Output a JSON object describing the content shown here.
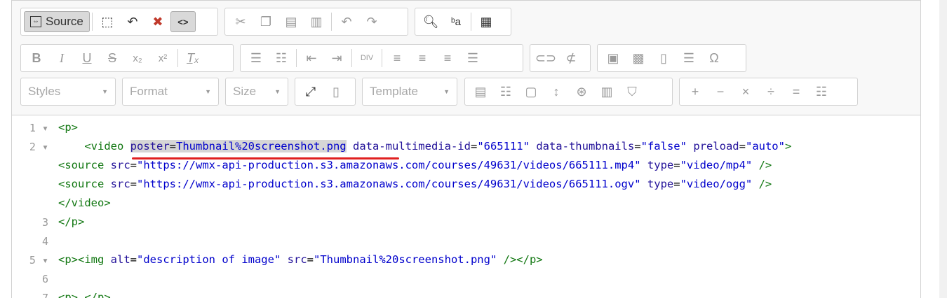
{
  "toolbar": {
    "source_label": "Source",
    "styles_label": "Styles",
    "format_label": "Format",
    "size_label": "Size",
    "template_label": "Template"
  },
  "code_lines": [
    {
      "num": "1",
      "fold": "▾",
      "parts": [
        [
          "t",
          "<p>"
        ]
      ]
    },
    {
      "num": "2",
      "fold": "▾",
      "parts": [
        [
          "t",
          "    <video "
        ],
        [
          "ah",
          "poster"
        ],
        [
          "h",
          "="
        ],
        [
          "sh",
          "Thumbnail%20screenshot.png"
        ],
        [
          "p",
          " "
        ],
        [
          "a",
          "data-multimedia-id"
        ],
        [
          "p",
          "="
        ],
        [
          "s",
          "\"665111\""
        ],
        [
          "p",
          " "
        ],
        [
          "a",
          "data-thumbnails"
        ],
        [
          "p",
          "="
        ],
        [
          "s",
          "\"false\""
        ],
        [
          "p",
          " "
        ],
        [
          "a",
          "preload"
        ],
        [
          "p",
          "="
        ],
        [
          "s",
          "\"auto\""
        ],
        [
          "t",
          ">"
        ]
      ]
    },
    {
      "num": "",
      "fold": "",
      "parts": [
        [
          "t",
          "<source "
        ],
        [
          "a",
          "src"
        ],
        [
          "p",
          "="
        ],
        [
          "s",
          "\"https://wmx-api-production.s3.amazonaws.com/courses/49631/videos/665111.mp4\""
        ],
        [
          "p",
          " "
        ],
        [
          "a",
          "type"
        ],
        [
          "p",
          "="
        ],
        [
          "s",
          "\"video/mp4\""
        ],
        [
          "p",
          " "
        ],
        [
          "t",
          "/>"
        ]
      ]
    },
    {
      "num": "",
      "fold": "",
      "parts": [
        [
          "t",
          "<source "
        ],
        [
          "a",
          "src"
        ],
        [
          "p",
          "="
        ],
        [
          "s",
          "\"https://wmx-api-production.s3.amazonaws.com/courses/49631/videos/665111.ogv\""
        ],
        [
          "p",
          " "
        ],
        [
          "a",
          "type"
        ],
        [
          "p",
          "="
        ],
        [
          "s",
          "\"video/ogg\""
        ],
        [
          "p",
          " "
        ],
        [
          "t",
          "/>"
        ]
      ]
    },
    {
      "num": "",
      "fold": "",
      "parts": [
        [
          "t",
          "</video>"
        ]
      ]
    },
    {
      "num": "3",
      "fold": "",
      "parts": [
        [
          "t",
          "</p>"
        ]
      ]
    },
    {
      "num": "4",
      "fold": "",
      "parts": []
    },
    {
      "num": "5",
      "fold": "▾",
      "parts": [
        [
          "t",
          "<p><img "
        ],
        [
          "a",
          "alt"
        ],
        [
          "p",
          "="
        ],
        [
          "s",
          "\"description of image\""
        ],
        [
          "p",
          " "
        ],
        [
          "a",
          "src"
        ],
        [
          "p",
          "="
        ],
        [
          "s",
          "\"Thumbnail%20screenshot.png\""
        ],
        [
          "p",
          " "
        ],
        [
          "t",
          "/></p>"
        ]
      ]
    },
    {
      "num": "6",
      "fold": "",
      "parts": []
    },
    {
      "num": "7",
      "fold": "",
      "parts": [
        [
          "t",
          "<p> </p>"
        ]
      ]
    }
  ]
}
